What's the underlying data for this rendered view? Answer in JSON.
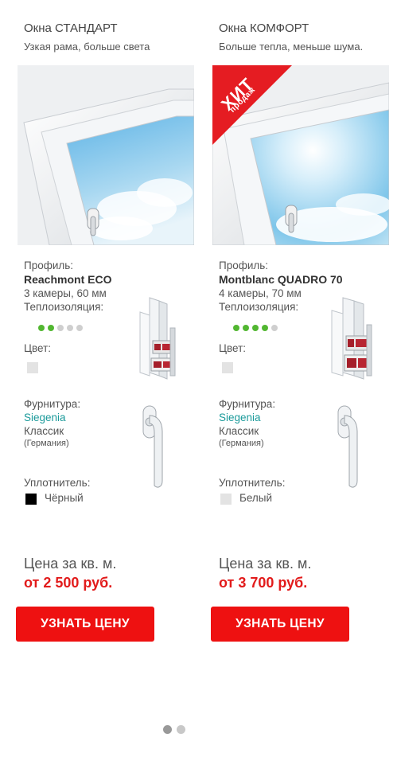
{
  "colors": {
    "accent": "#ee1111",
    "price": "#e21b1b",
    "link": "#1a9a9a",
    "dot_active": "#52b731",
    "dot_inactive": "#cfcfcf"
  },
  "cards": [
    {
      "title": "Окна СТАНДАРТ",
      "subtitle": "Узкая рама, больше света",
      "badge": null,
      "profile_label": "Профиль:",
      "profile_name": "Reachmont ECO",
      "profile_specs": "3 камеры, 60 мм",
      "insulation_label": "Теплоизоляция:",
      "insulation_level": 2,
      "insulation_max": 5,
      "color_label": "Цвет:",
      "fittings_label": "Фурнитура:",
      "fittings_brand": "Siegenia",
      "fittings_model": "Классик",
      "fittings_origin": "(Германия)",
      "seal_label": "Уплотнитель:",
      "seal_value": "Чёрный",
      "seal_color": "#000000",
      "price_label": "Цена за кв. м.",
      "price_value": "от 2 500 руб.",
      "button_label": "УЗНАТЬ ЦЕНУ"
    },
    {
      "title": "Окна КОМФОРТ",
      "subtitle": "Больше тепла, меньше шума.",
      "badge": {
        "line1": "ХИТ",
        "line2": "продаж"
      },
      "profile_label": "Профиль:",
      "profile_name": "Montblanc QUADRO 70",
      "profile_specs": "4 камеры, 70 мм",
      "insulation_label": "Теплоизоляция:",
      "insulation_level": 4,
      "insulation_max": 5,
      "color_label": "Цвет:",
      "fittings_label": "Фурнитура:",
      "fittings_brand": "Siegenia",
      "fittings_model": "Классик",
      "fittings_origin": "(Германия)",
      "seal_label": "Уплотнитель:",
      "seal_value": "Белый",
      "seal_color": "#e3e3e3",
      "price_label": "Цена за кв. м.",
      "price_value": "от 3 700 руб.",
      "button_label": "УЗНАТЬ ЦЕНУ"
    }
  ],
  "pagination": {
    "pages": 2,
    "current": 1
  }
}
